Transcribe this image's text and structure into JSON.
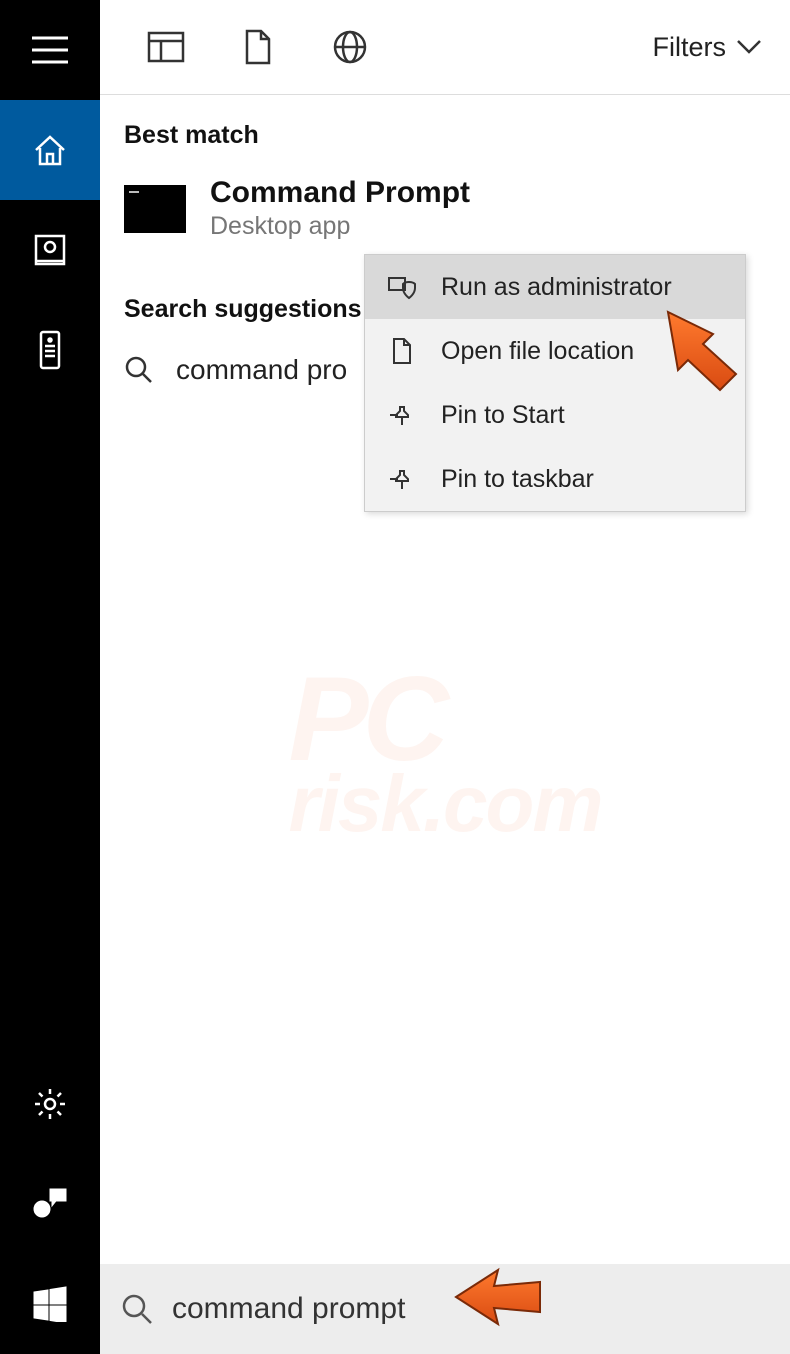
{
  "sidebar": {
    "items": [
      {
        "name": "menu"
      },
      {
        "name": "home",
        "active": true
      },
      {
        "name": "photos"
      },
      {
        "name": "remote"
      }
    ],
    "bottom_items": [
      {
        "name": "settings"
      },
      {
        "name": "feedback"
      },
      {
        "name": "start"
      }
    ]
  },
  "top": {
    "filters_label": "Filters"
  },
  "results": {
    "best_match_label": "Best match",
    "item": {
      "title": "Command Prompt",
      "subtitle": "Desktop app"
    },
    "suggestions_label": "Search suggestions",
    "suggestion_text": "command pro"
  },
  "context_menu": {
    "items": [
      {
        "label": "Run as administrator",
        "icon": "shield"
      },
      {
        "label": "Open file location",
        "icon": "file"
      },
      {
        "label": "Pin to Start",
        "icon": "pin"
      },
      {
        "label": "Pin to taskbar",
        "icon": "pin"
      }
    ]
  },
  "search": {
    "value": "command prompt"
  },
  "watermark": {
    "line1": "PC",
    "line2": "risk.com"
  }
}
